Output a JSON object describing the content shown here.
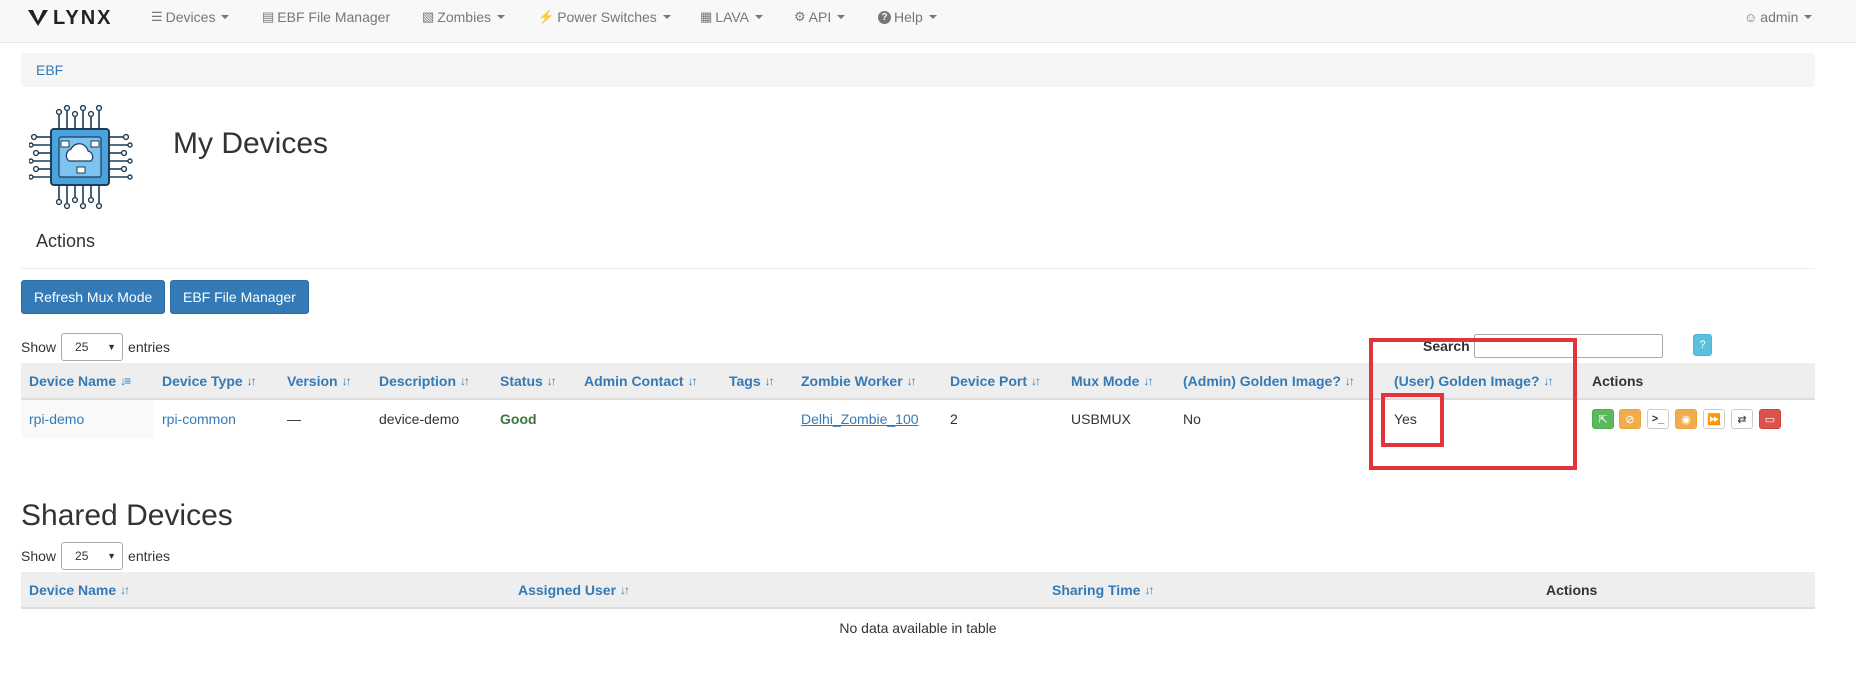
{
  "nav": {
    "brand": "LYNX",
    "items": [
      {
        "label": "Devices",
        "icon": "server-icon",
        "glyph": "☰"
      },
      {
        "label": "EBF File Manager",
        "icon": "folder-open-icon",
        "glyph": "▤"
      },
      {
        "label": "Zombies",
        "icon": "zombie-icon",
        "glyph": "▧"
      },
      {
        "label": "Power Switches",
        "icon": "bolt-icon",
        "glyph": "⚡"
      },
      {
        "label": "LAVA",
        "icon": "calendar-icon",
        "glyph": "▦"
      },
      {
        "label": "API",
        "icon": "gear-icon",
        "glyph": "⚙"
      },
      {
        "label": "Help",
        "icon": "question-circle-icon",
        "glyph": "?"
      }
    ],
    "user": {
      "label": "admin",
      "icon": "user-icon",
      "glyph": "☺"
    }
  },
  "breadcrumb": {
    "item": "EBF"
  },
  "header": {
    "title": "My Devices"
  },
  "actions": {
    "title": "Actions",
    "refresh_label": "Refresh Mux Mode",
    "ebf_label": "EBF File Manager"
  },
  "my_devices_table": {
    "show_label": "Show",
    "entries_label": "entries",
    "page_length": "25",
    "search_label": "Search",
    "search_value": "",
    "help_label": "?",
    "columns": [
      "Device Name",
      "Device Type",
      "Version",
      "Description",
      "Status",
      "Admin Contact",
      "Tags",
      "Zombie Worker",
      "Device Port",
      "Mux Mode",
      "(Admin) Golden Image?",
      "(User) Golden Image?",
      "Actions"
    ],
    "rows": [
      {
        "device_name": "rpi-demo",
        "device_type": "rpi-common",
        "version": "—",
        "description": "device-demo",
        "status": "Good",
        "admin_contact": "",
        "tags": "",
        "zombie_worker": "Delhi_Zombie_100",
        "device_port": "2",
        "mux_mode": "USBMUX",
        "admin_golden": "No",
        "user_golden": "Yes"
      }
    ],
    "row_actions": [
      {
        "name": "deploy-icon",
        "style": "green"
      },
      {
        "name": "ban-icon",
        "style": "orange"
      },
      {
        "name": "terminal-icon",
        "style": "white"
      },
      {
        "name": "record-icon",
        "style": "orange"
      },
      {
        "name": "fast-forward-icon",
        "style": "white"
      },
      {
        "name": "random-icon",
        "style": "white"
      },
      {
        "name": "trash-icon",
        "style": "red"
      }
    ]
  },
  "shared": {
    "title": "Shared Devices",
    "show_label": "Show",
    "entries_label": "entries",
    "page_length": "25",
    "columns": [
      "Device Name",
      "Assigned User",
      "Sharing Time",
      "Actions"
    ],
    "empty": "No data available in table"
  },
  "colors": {
    "primary": "#337ab7",
    "good": "#3c763d",
    "highlight": "#e2353b"
  }
}
